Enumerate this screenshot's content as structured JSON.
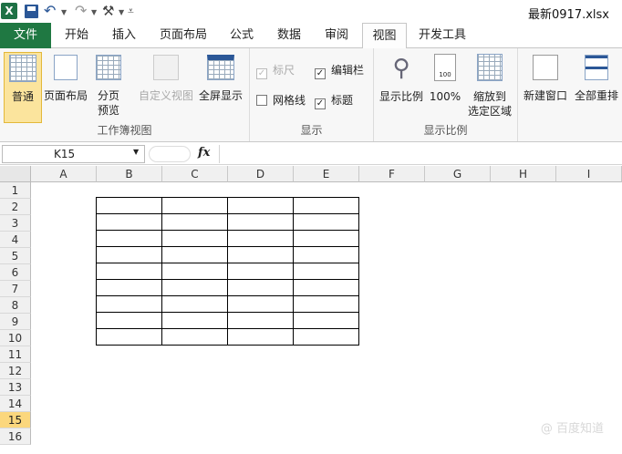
{
  "titlebar": {
    "app_icon": "X",
    "filename": "最新0917.xlsx"
  },
  "tabs": [
    "文件",
    "开始",
    "插入",
    "页面布局",
    "公式",
    "数据",
    "审阅",
    "视图",
    "开发工具"
  ],
  "ribbon": {
    "workbook_views": {
      "label": "工作簿视图",
      "normal": "普通",
      "page_layout": "页面布局",
      "page_break_1": "分页",
      "page_break_2": "预览",
      "custom": "自定义视图",
      "fullscreen": "全屏显示"
    },
    "show": {
      "label": "显示",
      "ruler": "标尺",
      "formula_bar": "编辑栏",
      "gridlines": "网格线",
      "headings": "标题",
      "ruler_checked": true,
      "formula_bar_checked": true,
      "gridlines_checked": false,
      "headings_checked": true
    },
    "zoom": {
      "label": "显示比例",
      "zoom": "显示比例",
      "hundred": "100%",
      "zoom_sel_1": "缩放到",
      "zoom_sel_2": "选定区域"
    },
    "window": {
      "new_window": "新建窗口",
      "arrange_all": "全部重排"
    }
  },
  "formula_bar": {
    "cell_ref": "K15",
    "fx": "fx",
    "value": ""
  },
  "columns": [
    "A",
    "B",
    "C",
    "D",
    "E",
    "F",
    "G",
    "H",
    "I"
  ],
  "rows": [
    "1",
    "2",
    "3",
    "4",
    "5",
    "6",
    "7",
    "8",
    "9",
    "10",
    "11",
    "12",
    "13",
    "14",
    "15",
    "16"
  ],
  "selected_row": "15",
  "watermark": "@ 百度知道",
  "colors": {
    "file_tab": "#1f7842",
    "active_button": "#fbe49d",
    "selected_row_header": "#fbd77d"
  }
}
